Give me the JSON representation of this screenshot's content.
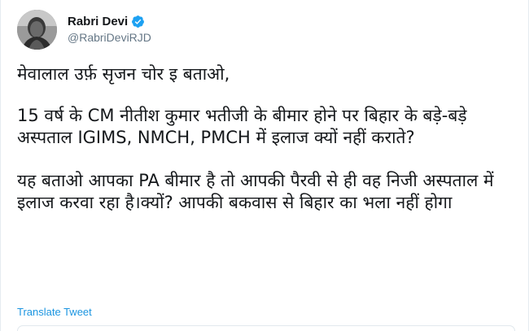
{
  "user": {
    "name": "Rabri Devi",
    "handle": "@RabriDeviRJD",
    "verified": true,
    "avatar_icon": "profile-photo",
    "verified_icon": "verified-badge-icon"
  },
  "tweet": {
    "paragraphs": [
      "मेवालाल उर्फ़ सृजन चोर इ बताओ,",
      "15 वर्ष के CM नीतीश कुमार भतीजी के बीमार होने पर बिहार के बड़े-बड़े अस्पताल IGIMS, NMCH, PMCH में इलाज क्यों नहीं कराते?",
      "यह बताओ आपका PA बीमार है तो आपकी पैरवी से ही वह निजी अस्पताल में इलाज करवा रहा है।क्यों? आपकी बकवास से बिहार का भला नहीं होगा"
    ]
  },
  "actions": {
    "translate_label": "Translate Tweet"
  },
  "colors": {
    "link": "#1b95e0",
    "secondary_text": "#657786",
    "verified": "#1da1f2"
  }
}
